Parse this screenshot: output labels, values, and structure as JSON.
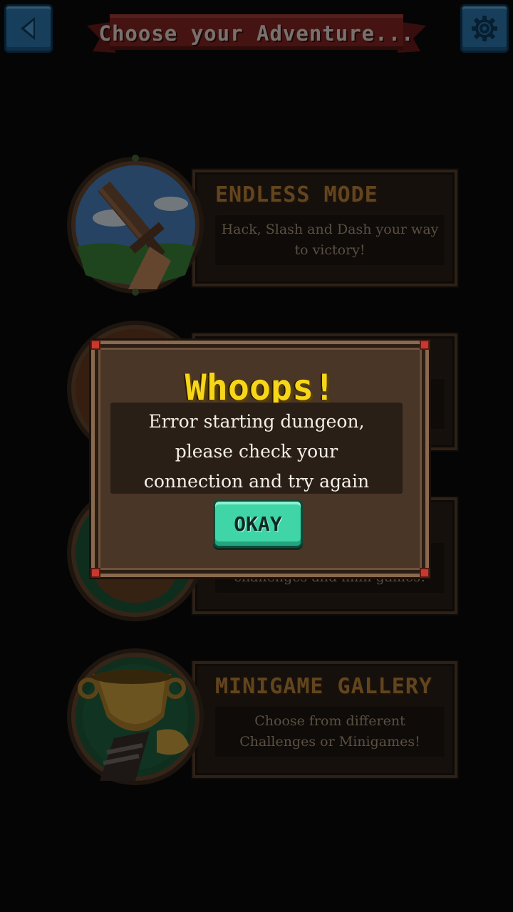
{
  "header": {
    "title": "Choose your Adventure...",
    "back_icon": "back-arrow-icon",
    "settings_icon": "gear-icon"
  },
  "cards": [
    {
      "title": "ENDLESS MODE",
      "description": "Hack, Slash and Dash your way to victory!",
      "icon": "sword-icon"
    },
    {
      "title": "",
      "description": "",
      "icon": "dungeon-icon"
    },
    {
      "title": "",
      "description": "challenges and mini games!",
      "icon": "boss-icon"
    },
    {
      "title": "MINIGAME GALLERY",
      "description": "Choose from different Challenges or Minigames!",
      "icon": "trophy-icon"
    }
  ],
  "dialog": {
    "title": "Whoops!",
    "message_lines": [
      "Error starting dungeon,",
      "please check your",
      "connection and try again"
    ],
    "ok_label": "OKAY"
  },
  "colors": {
    "dialog_title": "#f7d61a",
    "ok_button": "#3fd5a6",
    "icon_button": "#2f7fb6",
    "card_title": "#c48b3c"
  }
}
